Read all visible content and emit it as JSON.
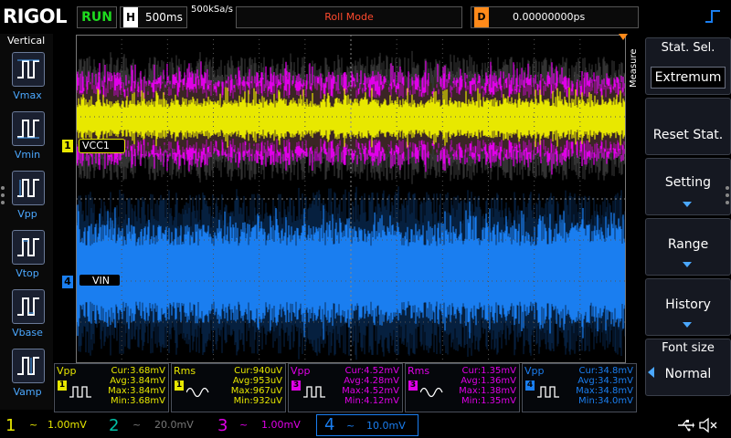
{
  "top": {
    "logo": "RIGOL",
    "run": "RUN",
    "h_label": "H",
    "timebase": "500ms",
    "sample_rate": "500kSa/s",
    "mode": "Roll Mode",
    "d_label": "D",
    "delay": "0.00000000ps"
  },
  "left_menu": {
    "title": "Vertical",
    "items": [
      {
        "label": "Vmax",
        "icon": "vmax-icon"
      },
      {
        "label": "Vmin",
        "icon": "vmin-icon"
      },
      {
        "label": "Vpp",
        "icon": "vpp-icon"
      },
      {
        "label": "Vtop",
        "icon": "vtop-icon"
      },
      {
        "label": "Vbase",
        "icon": "vbase-icon"
      },
      {
        "label": "Vamp",
        "icon": "vamp-icon"
      }
    ]
  },
  "right_menu": {
    "tab": "Measure",
    "stat_sel": {
      "title": "Stat. Sel.",
      "value": "Extremum"
    },
    "reset": "Reset Stat.",
    "setting": "Setting",
    "range": "Range",
    "history": "History",
    "font_size": {
      "title": "Font size",
      "value": "Normal"
    }
  },
  "traces": {
    "ch1_label": "VCC1",
    "ch1_num": "1",
    "ch4_label": "VIN",
    "ch4_num": "4",
    "colors": {
      "ch1": "#e8e800",
      "ch2": "#00c2a8",
      "ch3": "#e000e8",
      "ch4": "#1a7ef0"
    }
  },
  "measurements": [
    {
      "name": "Vpp",
      "ch": "1",
      "cur": "Cur:3.68mV",
      "avg": "Avg:3.84mV",
      "max": "Max:3.84mV",
      "min": "Min:3.68mV",
      "color": "#e8e800"
    },
    {
      "name": "Rms",
      "ch": "1",
      "cur": "Cur:940uV",
      "avg": "Avg:953uV",
      "max": "Max:967uV",
      "min": "Min:932uV",
      "color": "#e8e800"
    },
    {
      "name": "Vpp",
      "ch": "3",
      "cur": "Cur:4.52mV",
      "avg": "Avg:4.28mV",
      "max": "Max:4.52mV",
      "min": "Min:4.12mV",
      "color": "#e000e8"
    },
    {
      "name": "Rms",
      "ch": "3",
      "cur": "Cur:1.35mV",
      "avg": "Avg:1.36mV",
      "max": "Max:1.38mV",
      "min": "Min:1.35mV",
      "color": "#e000e8"
    },
    {
      "name": "Vpp",
      "ch": "4",
      "cur": "Cur:34.8mV",
      "avg": "Avg:34.3mV",
      "max": "Max:34.8mV",
      "min": "Min:34.0mV",
      "color": "#1a7ef0"
    }
  ],
  "channels": [
    {
      "num": "1",
      "coupling": "~",
      "scale": "1.00mV",
      "color": "#e8e800"
    },
    {
      "num": "2",
      "coupling": "~",
      "scale": "20.0mV",
      "color": "#00c2a8"
    },
    {
      "num": "3",
      "coupling": "~",
      "scale": "1.00mV",
      "color": "#e000e8"
    },
    {
      "num": "4",
      "coupling": "~",
      "scale": "10.0mV",
      "color": "#1a7ef0"
    }
  ]
}
